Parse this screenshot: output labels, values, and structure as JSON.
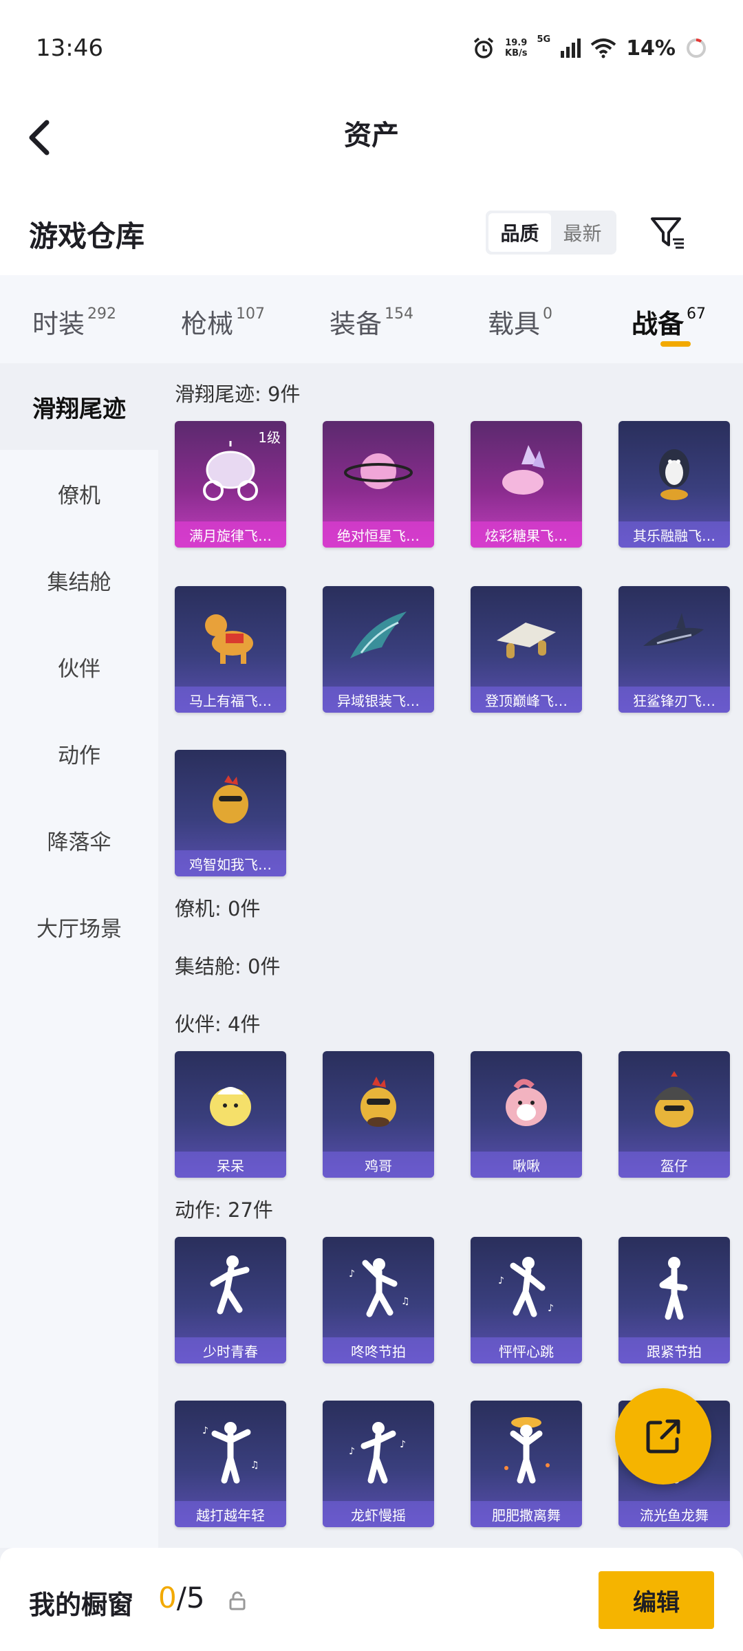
{
  "status_bar": {
    "time": "13:46",
    "speed_value": "19.9",
    "speed_unit": "KB/s",
    "network": "5G",
    "battery": "14%"
  },
  "header": {
    "title": "资产"
  },
  "warehouse": {
    "title": "游戏仓库",
    "sort_quality": "品质",
    "sort_newest": "最新"
  },
  "category_tabs": [
    {
      "label": "时装",
      "count": "292"
    },
    {
      "label": "枪械",
      "count": "107"
    },
    {
      "label": "装备",
      "count": "154"
    },
    {
      "label": "载具",
      "count": "0"
    },
    {
      "label": "战备",
      "count": "67"
    }
  ],
  "sidebar": {
    "items": [
      "滑翔尾迹",
      "僚机",
      "集结舱",
      "伙伴",
      "动作",
      "降落伞",
      "大厅场景"
    ]
  },
  "sections": {
    "glide": {
      "title": "滑翔尾迹: 9件",
      "items": [
        {
          "name": "满月旋律飞…",
          "level": "1级"
        },
        {
          "name": "绝对恒星飞…"
        },
        {
          "name": "炫彩糖果飞…"
        },
        {
          "name": "其乐融融飞…"
        },
        {
          "name": "马上有福飞…"
        },
        {
          "name": "异域银装飞…"
        },
        {
          "name": "登顶巅峰飞…"
        },
        {
          "name": "狂鲨锋刃飞…"
        },
        {
          "name": "鸡智如我飞…"
        }
      ]
    },
    "wingman": {
      "title": "僚机: 0件"
    },
    "pod": {
      "title": "集结舱: 0件"
    },
    "partner": {
      "title": "伙伴: 4件",
      "items": [
        {
          "name": "呆呆"
        },
        {
          "name": "鸡哥"
        },
        {
          "name": "啾啾"
        },
        {
          "name": "盔仔"
        }
      ]
    },
    "emote": {
      "title": "动作: 27件",
      "items": [
        {
          "name": "少时青春"
        },
        {
          "name": "咚咚节拍"
        },
        {
          "name": "怦怦心跳"
        },
        {
          "name": "跟紧节拍"
        },
        {
          "name": "越打越年轻"
        },
        {
          "name": "龙虾慢摇"
        },
        {
          "name": "肥肥撒离舞"
        },
        {
          "name": "流光鱼龙舞"
        }
      ]
    }
  },
  "bottom_bar": {
    "label": "我的橱窗",
    "count_current": "0",
    "count_total": "/5",
    "edit_label": "编辑"
  },
  "colors": {
    "accent": "#f5b400",
    "card_blue": "#3a3f7e",
    "card_purple": "#a8339f"
  }
}
